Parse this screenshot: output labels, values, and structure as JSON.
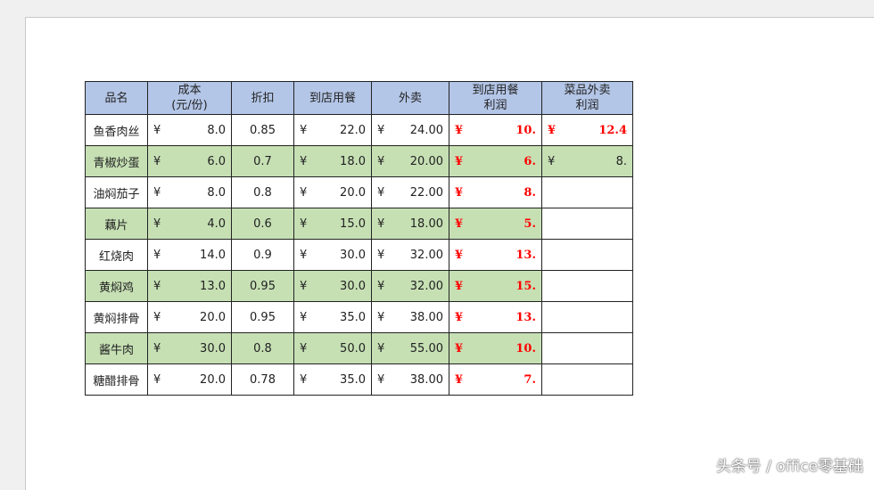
{
  "headers": [
    "品名",
    "成本\n(元/份)",
    "折扣",
    "到店用餐",
    "外卖",
    "到店用餐\n利润",
    "菜品外卖\n利润"
  ],
  "currency": "¥",
  "rows": [
    {
      "name": "鱼香肉丝",
      "cost": "8.0",
      "discount": "0.85",
      "dinein": "22.0",
      "takeout": "24.00",
      "dinein_profit": "10.",
      "takeout_profit": "12.4"
    },
    {
      "name": "青椒炒蛋",
      "cost": "6.0",
      "discount": "0.7",
      "dinein": "18.0",
      "takeout": "20.00",
      "dinein_profit": "6.",
      "takeout_profit": "8."
    },
    {
      "name": "油焖茄子",
      "cost": "8.0",
      "discount": "0.8",
      "dinein": "20.0",
      "takeout": "22.00",
      "dinein_profit": "8.",
      "takeout_profit": ""
    },
    {
      "name": "藕片",
      "cost": "4.0",
      "discount": "0.6",
      "dinein": "15.0",
      "takeout": "18.00",
      "dinein_profit": "5.",
      "takeout_profit": ""
    },
    {
      "name": "红烧肉",
      "cost": "14.0",
      "discount": "0.9",
      "dinein": "30.0",
      "takeout": "32.00",
      "dinein_profit": "13.",
      "takeout_profit": ""
    },
    {
      "name": "黄焖鸡",
      "cost": "13.0",
      "discount": "0.95",
      "dinein": "30.0",
      "takeout": "32.00",
      "dinein_profit": "15.",
      "takeout_profit": ""
    },
    {
      "name": "黄焖排骨",
      "cost": "20.0",
      "discount": "0.95",
      "dinein": "35.0",
      "takeout": "38.00",
      "dinein_profit": "13.",
      "takeout_profit": ""
    },
    {
      "name": "酱牛肉",
      "cost": "30.0",
      "discount": "0.8",
      "dinein": "50.0",
      "takeout": "55.00",
      "dinein_profit": "10.",
      "takeout_profit": ""
    },
    {
      "name": "糖醋排骨",
      "cost": "20.0",
      "discount": "0.78",
      "dinein": "35.0",
      "takeout": "38.00",
      "dinein_profit": "7.",
      "takeout_profit": ""
    }
  ],
  "watermark": "头条号 / office零基础"
}
